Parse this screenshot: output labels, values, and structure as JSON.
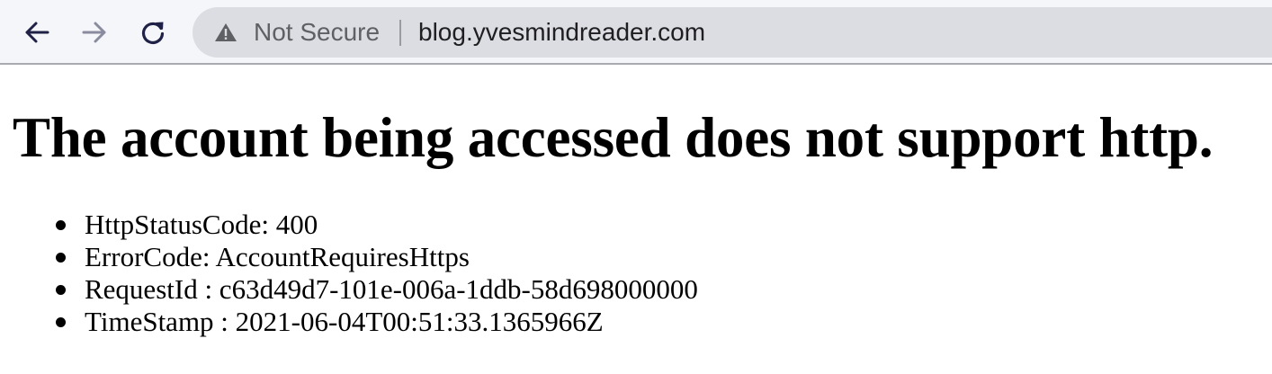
{
  "browser": {
    "nav": {
      "back_icon": "arrow-left-icon",
      "forward_icon": "arrow-right-icon",
      "reload_icon": "reload-icon"
    },
    "omnibox": {
      "security_icon": "warning-triangle-icon",
      "security_label": "Not Secure",
      "url": "blog.yvesmindreader.com"
    }
  },
  "page": {
    "title": "The account being accessed does not support http.",
    "details": [
      "HttpStatusCode: 400",
      "ErrorCode: AccountRequiresHttps",
      "RequestId : c63d49d7-101e-006a-1ddb-58d698000000",
      "TimeStamp : 2021-06-04T00:51:33.1365966Z"
    ]
  },
  "colors": {
    "toolbar_bg": "#f5f6fa",
    "omnibox_bg": "#dcdde2",
    "nav_icon_active": "#202146",
    "nav_icon_disabled": "#8a8b9e"
  }
}
